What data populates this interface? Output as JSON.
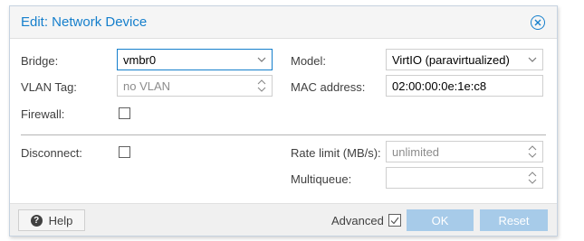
{
  "window": {
    "title": "Edit: Network Device",
    "close_icon": "close-circle-icon"
  },
  "left": {
    "bridge": {
      "label": "Bridge:",
      "value": "vmbr0"
    },
    "vlan": {
      "label": "VLAN Tag:",
      "value": "no VLAN"
    },
    "firewall": {
      "label": "Firewall:",
      "checked": false
    },
    "disconnect": {
      "label": "Disconnect:",
      "checked": false
    }
  },
  "right": {
    "model": {
      "label": "Model:",
      "value": "VirtIO (paravirtualized)"
    },
    "mac": {
      "label": "MAC address:",
      "value": "02:00:00:0e:1e:c8"
    },
    "rate_limit": {
      "label": "Rate limit (MB/s):",
      "value": "unlimited"
    },
    "multiqueue": {
      "label": "Multiqueue:",
      "value": ""
    }
  },
  "footer": {
    "help_label": "Help",
    "advanced_label": "Advanced",
    "advanced_checked": true,
    "ok_label": "OK",
    "reset_label": "Reset"
  },
  "colors": {
    "accent": "#157fcc",
    "primary_button_disabled": "#a7cbe9"
  }
}
